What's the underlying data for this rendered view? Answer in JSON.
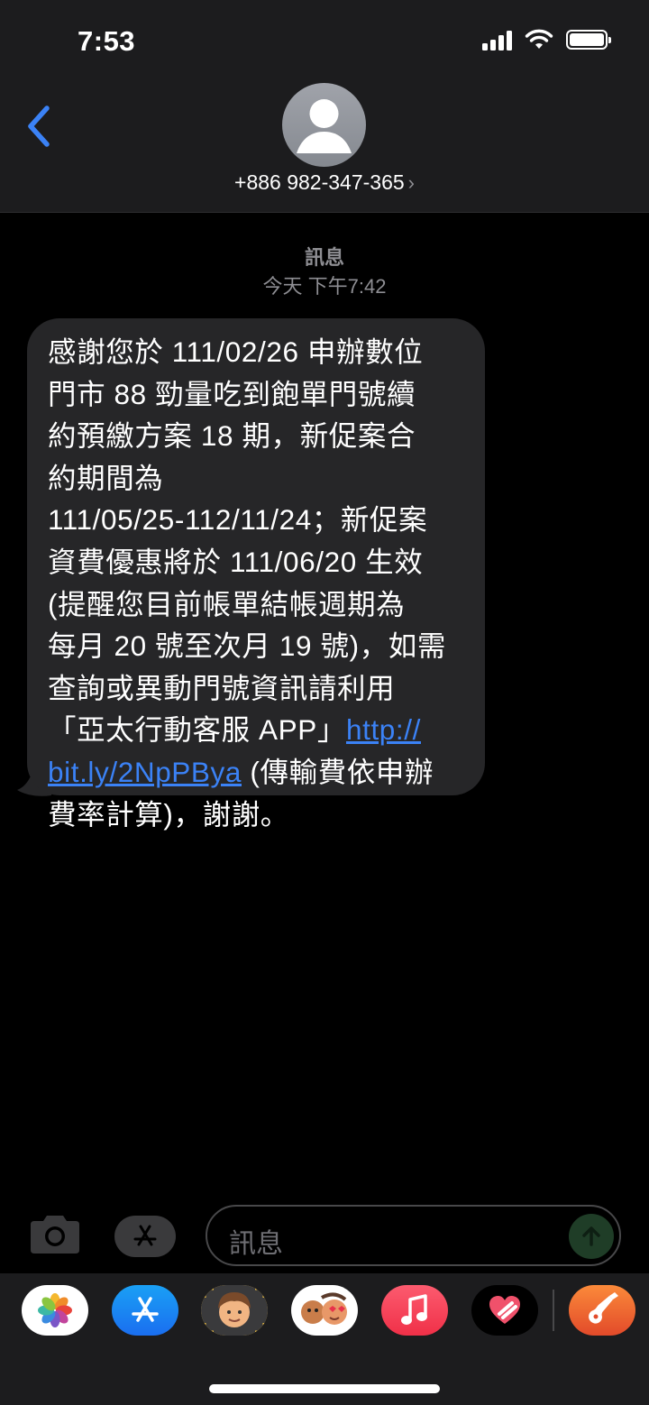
{
  "status_bar": {
    "time": "7:53"
  },
  "header": {
    "contact_number": "+886 982-347-365",
    "chevron": "›"
  },
  "thread_meta": {
    "service_label": "訊息",
    "timestamp": "今天 下午7:42"
  },
  "message": {
    "line1": "感謝您於 111/02/26 申辦數位",
    "line2": "門市 88 勁量吃到飽單門號續",
    "line3": "約預繳方案 18 期，新促案合",
    "line4": "約期間為",
    "line5": "111/05/25-112/11/24；新促案",
    "line6": "資費優惠將於 111/06/20 生效",
    "line7": "(提醒您目前帳單結帳週期為",
    "line8": "每月 20 號至次月 19 號)，如需",
    "line9": "查詢或異動門號資訊請利用",
    "line10_text": "「亞太行動客服 APP」",
    "link_part1": "http://",
    "link_part2": "bit.ly/2NpPBya",
    "line11_text": " (傳輸費依申辦",
    "line12": "費率計算)，謝謝。"
  },
  "composer": {
    "placeholder": "訊息"
  },
  "dock_apps": [
    "photos-icon",
    "app-store-icon",
    "memoji-icon",
    "animoji-icon",
    "music-icon",
    "digital-touch-icon",
    "garageband-icon"
  ],
  "colors": {
    "link": "#3b82f6",
    "back_arrow": "#3b82f6",
    "bubble": "#262628",
    "header": "#1c1c1e"
  }
}
